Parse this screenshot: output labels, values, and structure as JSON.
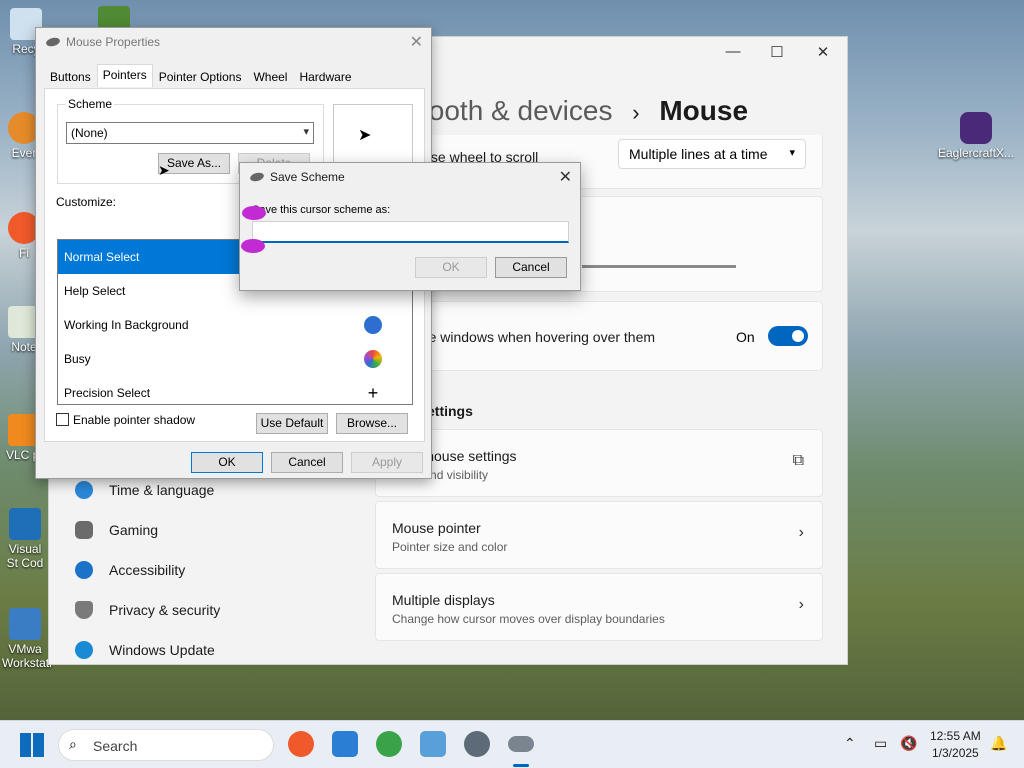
{
  "desktop": {
    "icons": [
      {
        "label": "Recy"
      },
      {
        "label": "Ever"
      },
      {
        "label": "Fi"
      },
      {
        "label": "Note"
      },
      {
        "label": "VLC pl"
      },
      {
        "label": "Visual St Cod"
      },
      {
        "label": "VMwa Workstati"
      }
    ],
    "right_icon": {
      "label": "EaglercraftX..."
    }
  },
  "settings": {
    "breadcrumb_parent": "tooth & devices",
    "breadcrumb_sep": "›",
    "breadcrumb_current": "Mouse",
    "wheel_label": "e mouse wheel to scroll",
    "wheel_value": "Multiple lines at a time",
    "inactive_label": "nactive windows when hovering over them",
    "inactive_state": "On",
    "section_heading": "ettings",
    "additional": {
      "label": "onal mouse settings",
      "sub": "icons and visibility"
    },
    "pointer": {
      "label": "Mouse pointer",
      "sub": "Pointer size and color"
    },
    "displays": {
      "label": "Multiple displays",
      "sub": "Change how cursor moves over display boundaries"
    },
    "nav": [
      {
        "label": "Time & language",
        "color": "#2b88d8"
      },
      {
        "label": "Gaming",
        "color": "#6b6b6b"
      },
      {
        "label": "Accessibility",
        "color": "#1a73c8"
      },
      {
        "label": "Privacy & security",
        "color": "#7a7a7a"
      },
      {
        "label": "Windows Update",
        "color": "#1a8ad4"
      }
    ]
  },
  "mouse_props": {
    "title": "Mouse Properties",
    "tabs": [
      "Buttons",
      "Pointers",
      "Pointer Options",
      "Wheel",
      "Hardware"
    ],
    "active_tab": "Pointers",
    "scheme_label": "Scheme",
    "scheme_value": "(None)",
    "save_as": "Save As...",
    "delete": "Delete",
    "customize_label": "Customize:",
    "pointer_rows": [
      "Normal Select",
      "Help Select",
      "Working In Background",
      "Busy",
      "Precision Select"
    ],
    "shadow_label": "Enable pointer shadow",
    "use_default": "Use Default",
    "browse": "Browse...",
    "ok": "OK",
    "cancel": "Cancel",
    "apply": "Apply"
  },
  "save_scheme": {
    "title": "Save Scheme",
    "prompt": "Save this cursor scheme as:",
    "input_value": "",
    "ok": "OK",
    "cancel": "Cancel"
  },
  "taskbar": {
    "search_placeholder": "Search",
    "time": "12:55 AM",
    "date": "1/3/2025"
  }
}
